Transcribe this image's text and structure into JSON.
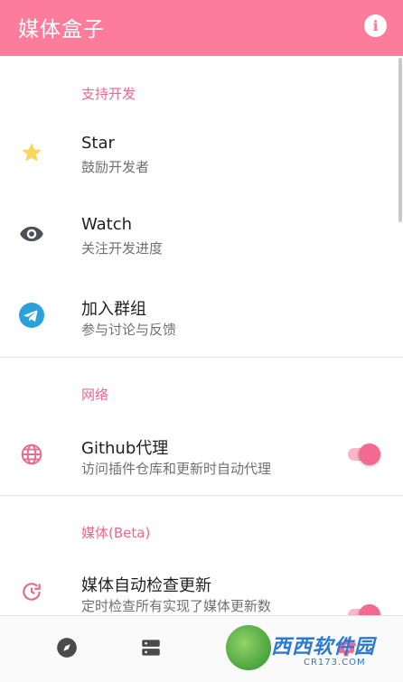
{
  "appbar": {
    "title": "媒体盒子",
    "bg_color": "#fd7b9b",
    "info_icon": "info-icon",
    "info_glyph": "i"
  },
  "sections": {
    "support": {
      "header": "支持开发",
      "items": [
        {
          "title": "Star",
          "subtitle": "鼓励开发者",
          "icon": "star-icon"
        },
        {
          "title": "Watch",
          "subtitle": "关注开发进度",
          "icon": "eye-icon"
        },
        {
          "title": "加入群组",
          "subtitle": "参与讨论与反馈",
          "icon": "telegram-icon"
        }
      ]
    },
    "network": {
      "header": "网络",
      "items": [
        {
          "title": "Github代理",
          "subtitle": "访问插件仓库和更新时自动代理",
          "icon": "globe-icon",
          "toggle": true
        }
      ]
    },
    "media": {
      "header": "媒体(Beta)",
      "items": [
        {
          "title": "媒体自动检查更新",
          "subtitle": "定时检查所有实现了媒体更新数",
          "icon": "update-icon",
          "toggle": true
        }
      ]
    }
  },
  "bottom_nav": [
    {
      "icon": "compass-icon"
    },
    {
      "icon": "storage-icon"
    },
    {
      "icon": "settings-icon"
    }
  ],
  "watermark": {
    "text": "西西软件园",
    "url": "CR173.COM"
  },
  "colors": {
    "accent": "#fd7b9b",
    "section_header": "#e86a8e",
    "toggle_on": "#f4698f",
    "star": "#f9d65c",
    "telegram": "#2aa1da"
  }
}
